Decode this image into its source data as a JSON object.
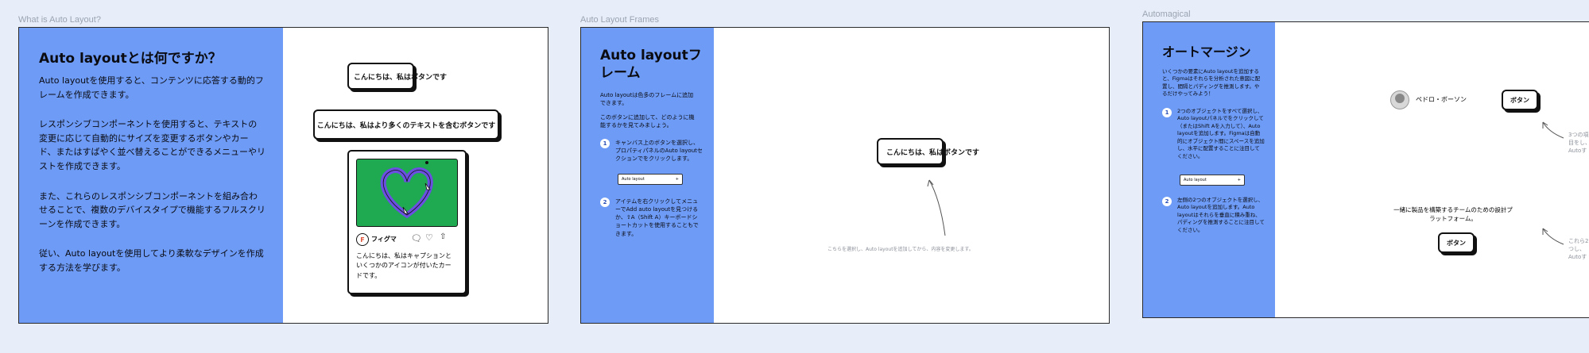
{
  "frames": [
    {
      "label": "What is Auto Layout?",
      "title": "Auto layoutとは何ですか？",
      "paragraphs": [
        "Auto layoutを使用すると、コンテンツに応答する動的フレームを作成できます。",
        "レスポンシブコンポーネントを使用すると、テキストの変更に応じて自動的にサイズを変更するボタンやカード、またはすばやく並べ替えることができるメニューやリストを作成できます。",
        "また、これらのレスポンシブコンポーネントを組み合わせることで、複数のデバイスタイプで機能するフルスクリーンを作成できます。",
        "従い、Auto layoutを使用してより柔軟なデザインを作成する方法を学びます。"
      ],
      "button_short": "こんにちは、私はボタンです",
      "button_long": "こんにちは、私はより多くのテキストを含むボタンです",
      "card": {
        "brand": "フィグマ",
        "caption": "こんにちは、私はキャプションといくつかのアイコンが付いたカードです。",
        "image_color": "#1faa52"
      }
    },
    {
      "label": "Auto Layout Frames",
      "title": "Auto layoutフレーム",
      "intro": "Auto layoutは色多のフレームに追加できます。",
      "intro2": "このボタンに追加して、どのように機能するかを見てみましょう。",
      "steps": [
        {
          "n": "1",
          "text": "キャンバス上のボタンを選択し、プロパティパネルのAuto layoutセクションでをクリックします。"
        },
        {
          "n": "2",
          "text": "アイテムを右クリックしてメニューでAdd auto layoutを見つけるか、⇧A（Shift A）キーボードショートカットを使用することもできます。"
        }
      ],
      "input_label": "Auto layout",
      "input_symbol": "+",
      "button": "こんにちは、私はボタンです",
      "hint": "こちらを選択し、Auto layoutを追加してから、内容を変更します。"
    },
    {
      "label": "Automagical",
      "title": "オートマージン",
      "intro": "いくつかの要素にAuto layoutを追加すると、Figmaはそれらを分析された意図に配置し、間隔とパディングを推測します。やるだけやってみよう！",
      "steps": [
        {
          "n": "1",
          "text": "2つのオブジェクトをすべて選択し、Auto layoutパネルでをクリックして（またはShift Aを入力して）、Auto layoutを追加します。Figmaは自動的にオブジェクト間にスペースを追加し、水平に配置することに注目してください。"
        },
        {
          "n": "2",
          "text": "Auto layoutを追加します。Auto layoutはそれらを垂直に積み重ね、パディングを推測することに注目してください。"
        }
      ],
      "step2_prefix": "左側の2つのオブジェクトを選択し、",
      "input_label": "Auto layout",
      "input_symbol": "+",
      "person": "ペドロ・ボーソン",
      "button": "ボタン",
      "team_text": "一緒に製品を構築するチームのための設計プラットフォーム。",
      "button2": "ボタン",
      "note1": "3つの項目をし、Autoす",
      "note2": "これら2つし、Autoす"
    }
  ]
}
